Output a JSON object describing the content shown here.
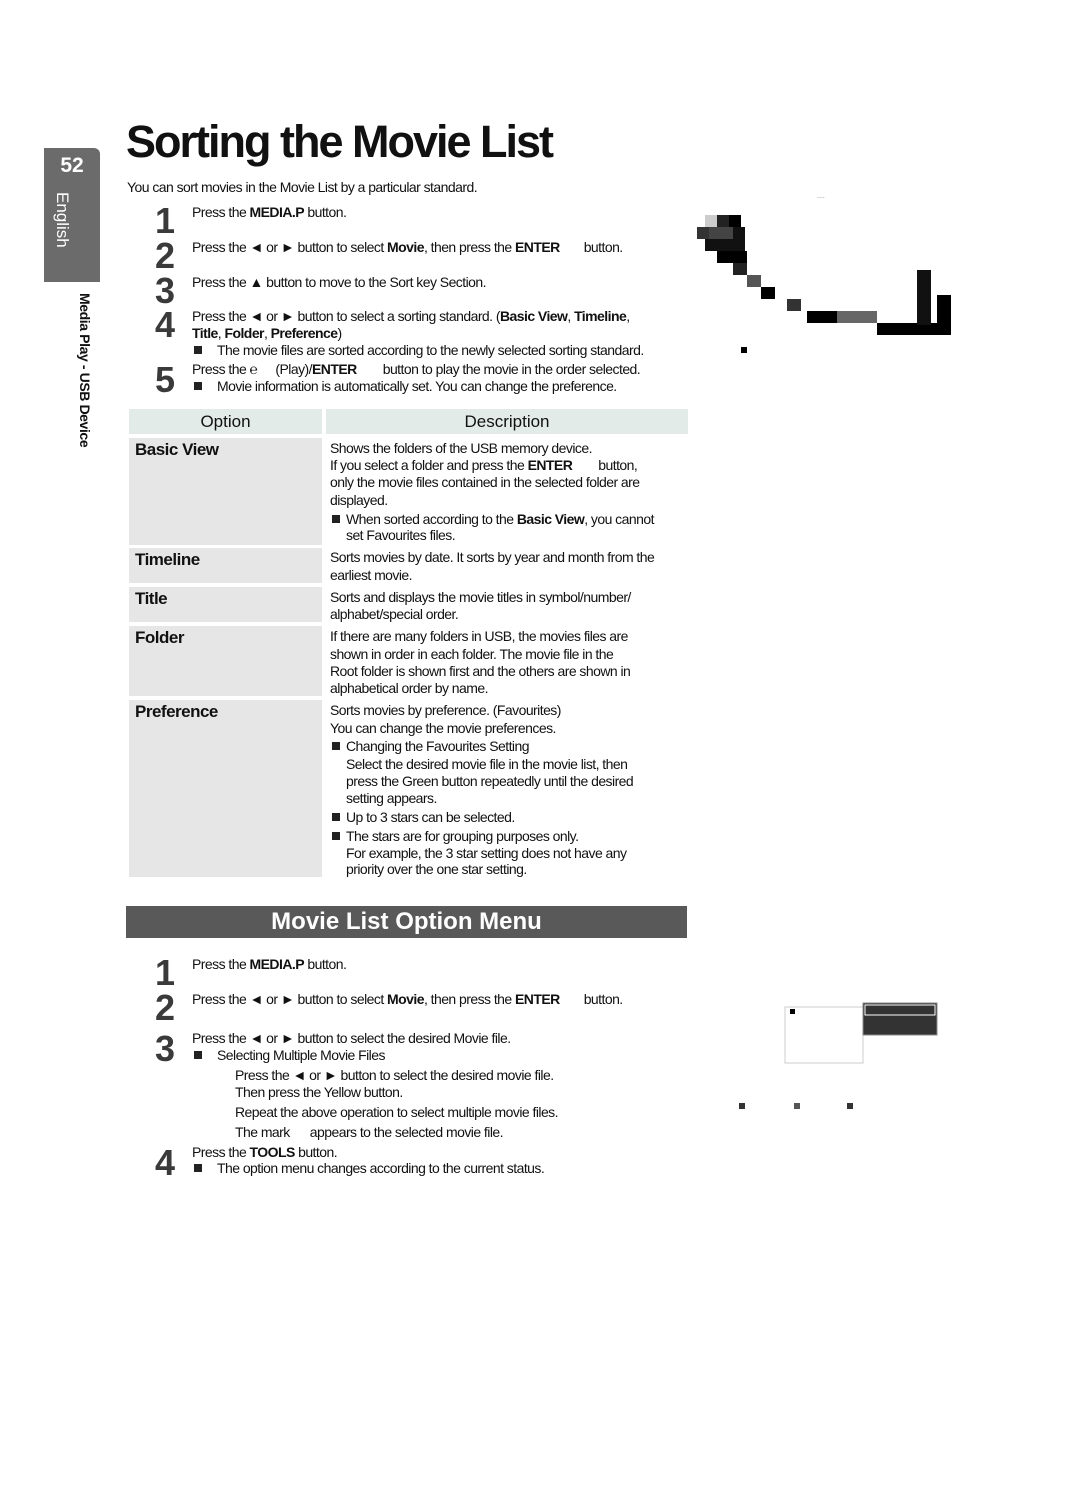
{
  "sidebar": {
    "page_number": "52",
    "language": "English",
    "section": "Media Play - USB Device"
  },
  "title": "Sorting the Movie List",
  "intro": "You can sort movies in the Movie List by a particular standard.",
  "sorting_steps": {
    "s1": {
      "num": "1",
      "a": "Press the ",
      "b": "MEDIA.P",
      "c": " button."
    },
    "s2": {
      "num": "2",
      "a": "Press the ◄ or ► button to select ",
      "b": "Movie",
      "c": ", then press the ",
      "d": "ENTER",
      "e": "button."
    },
    "s3": {
      "num": "3",
      "a": "Press the ▲ button to move to the Sort key Section."
    },
    "s4": {
      "num": "4",
      "a": "Press the ◄ or ► button to select a sorting standard. (",
      "b": "Basic View",
      "c": ", ",
      "d": "Timeline",
      "e": ",",
      "f": "Title",
      ", ": ", ",
      "g": "Folder",
      "h": ", ",
      "i": "Preference",
      "j": ")",
      "note": "The movie files are sorted according to the newly selected sorting standard."
    },
    "s5": {
      "num": "5",
      "a": "Press the ℮",
      "b": "(Play)/",
      "c": "ENTER",
      "d": "button to play the movie in the order selected.",
      "note": "Movie information is automatically set. You can change the preference."
    }
  },
  "table": {
    "headers": [
      "Option",
      "Description"
    ],
    "rows": [
      {
        "option": "Basic View",
        "lines": [
          "Shows the folders of the USB memory device."
        ],
        "l2a": "If you select a folder and press the ",
        "l2b": "ENTER",
        "l2c": "button,",
        "l3": "only the movie files contained in the selected folder are",
        "l4": "displayed.",
        "note_a": "When sorted according to the ",
        "note_b": "Basic View",
        ",": ",",
        "note_c": ", you cannot",
        "note_d": "set Favourites files."
      },
      {
        "option": "Timeline",
        "lines": [
          "Sorts movies by date. It sorts by year and month from the",
          "earliest movie."
        ]
      },
      {
        "option": "Title",
        "lines": [
          "Sorts and displays the movie titles in symbol/number/",
          "alphabet/special order."
        ]
      },
      {
        "option": "Folder",
        "lines": [
          "If there are many folders in USB, the movies files are",
          "shown in order in each folder. The movie file in the",
          "Root folder is shown first and the others are shown in",
          "alphabetical order by name."
        ]
      },
      {
        "option": "Preference",
        "lines": [
          "Sorts movies by preference. (Favourites)",
          "You can change the movie preferences."
        ],
        "bullets": [
          "Changing the Favourites Setting",
          "Up to 3 stars can be selected.",
          "The stars are for grouping purposes only."
        ],
        "sub1": [
          "Select the desired movie file in the movie list, then",
          "press the Green button repeatedly until the desired",
          "setting appears."
        ],
        "sub3": [
          "For example, the 3 star setting does not have any",
          "priority over the one star setting."
        ]
      }
    ]
  },
  "banner": "Movie List Option Menu",
  "option_steps": {
    "s1": {
      "num": "1",
      "a": "Press the ",
      "b": "MEDIA.P",
      "c": " button."
    },
    "s2": {
      "num": "2",
      "a": "Press the ◄ or ► button to select ",
      "b": "Movie",
      "c": ", then press the ",
      "d": "ENTER",
      "e": "button."
    },
    "s3": {
      "num": "3",
      "a": "Press the ◄ or ► button to select the desired Movie file.",
      "note": "Selecting Multiple Movie Files",
      "sub": [
        "Press the ◄ or ► button to select the desired movie file.",
        "Then press the Yellow button.",
        "Repeat the above operation to select multiple movie files.",
        "The mark      appears to the selected movie file."
      ]
    },
    "s4": {
      "num": "4",
      "a": "Press the ",
      "b": "TOOLS",
      "c": " button.",
      "note": "The option menu changes according to the current status."
    }
  },
  "colors": {
    "tab": "#6b6b6b",
    "banner": "#595959",
    "table_header": "#e2ebe8",
    "option_cell": "#e6e6e6"
  }
}
